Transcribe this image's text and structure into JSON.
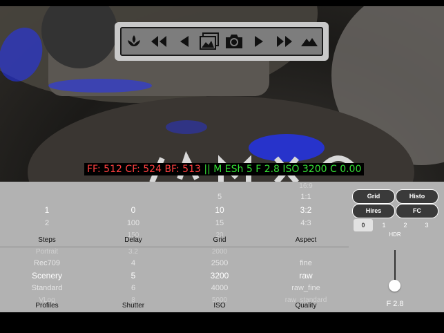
{
  "overlay": {
    "info_red": "FF: 512 CF: 524 BF: 513 ",
    "info_sep": "|| ",
    "info_green": "M ESh 5 F 2.8 ISO 3200 C 0.00"
  },
  "toolbar": {
    "icons": [
      "focus-peaking-icon",
      "fast-rewind-icon",
      "step-back-icon",
      "gallery-icon",
      "camera-icon",
      "play-icon",
      "fast-forward-icon",
      "mountain-icon"
    ]
  },
  "pickers_top": [
    {
      "label": "Steps",
      "above": [
        "",
        ""
      ],
      "selected": "1",
      "below": [
        "2",
        ""
      ]
    },
    {
      "label": "Delay",
      "above": [
        "",
        ""
      ],
      "selected": "0",
      "below": [
        "100",
        "150"
      ]
    },
    {
      "label": "Grid",
      "above": [
        "",
        "5"
      ],
      "selected": "10",
      "below": [
        "15",
        "20"
      ]
    },
    {
      "label": "Aspect",
      "above": [
        "16:9",
        "1:1"
      ],
      "selected": "3:2",
      "below": [
        "4:3",
        ""
      ]
    }
  ],
  "pickers_bottom": [
    {
      "label": "Profiles",
      "above": [
        "Portrait",
        "Rec709"
      ],
      "selected": "Scenery",
      "below": [
        "Standard",
        "VLog"
      ]
    },
    {
      "label": "Shutter",
      "above": [
        "3.2",
        "4"
      ],
      "selected": "5",
      "below": [
        "6",
        "8"
      ]
    },
    {
      "label": "ISO",
      "above": [
        "2000",
        "2500"
      ],
      "selected": "3200",
      "below": [
        "4000",
        "5000"
      ]
    },
    {
      "label": "Quality",
      "above": [
        "",
        "fine"
      ],
      "selected": "raw",
      "below": [
        "raw_fine",
        "raw_standard"
      ]
    }
  ],
  "buttons": {
    "grid": "Grid",
    "histo": "Histo",
    "hires": "Hires",
    "fc": "FC"
  },
  "hdr": {
    "label": "HDR",
    "options": [
      "0",
      "1",
      "2",
      "3"
    ],
    "selected_index": 0
  },
  "aperture": {
    "label": "F 2.8",
    "level": 0.85
  },
  "colors": {
    "panel": "#b2b2b2",
    "info_red": "#ff4040",
    "info_green": "#35e035",
    "focus_peaking": "#2233ff"
  }
}
